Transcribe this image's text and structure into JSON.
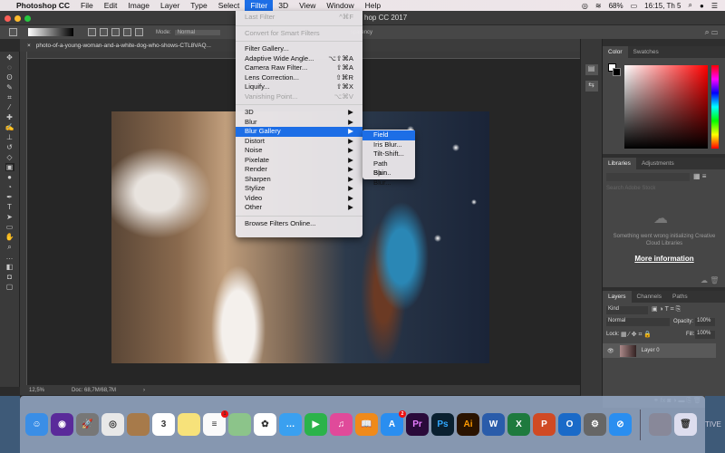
{
  "menubar": {
    "app": "Photoshop CC",
    "items": [
      "File",
      "Edit",
      "Image",
      "Layer",
      "Type",
      "Select",
      "Filter",
      "3D",
      "View",
      "Window",
      "Help"
    ],
    "active": "Filter",
    "status": {
      "battery": "68%",
      "clock": "16:15, Th 5"
    }
  },
  "window": {
    "title": "hop CC 2017"
  },
  "options": {
    "mode_label": "Mode:",
    "mode_value": "Normal",
    "transparency": "sparency"
  },
  "document": {
    "tab": "photo-of-a-young-woman-and-a-white-dog-who-shows-CTL8VAQ...",
    "zoom": "12,5%",
    "doc_size": "Doc: 68,7M/68,7M"
  },
  "filter_menu": {
    "group1": [
      {
        "label": "Last Filter",
        "shortcut": "^⌘F",
        "disabled": true
      }
    ],
    "group2": [
      {
        "label": "Convert for Smart Filters",
        "disabled": true
      }
    ],
    "group3": [
      {
        "label": "Filter Gallery...",
        "shortcut": ""
      },
      {
        "label": "Adaptive Wide Angle...",
        "shortcut": "⌥⇧⌘A"
      },
      {
        "label": "Camera Raw Filter...",
        "shortcut": "⇧⌘A"
      },
      {
        "label": "Lens Correction...",
        "shortcut": "⇧⌘R"
      },
      {
        "label": "Liquify...",
        "shortcut": "⇧⌘X"
      },
      {
        "label": "Vanishing Point...",
        "shortcut": "⌥⌘V",
        "disabled": true
      }
    ],
    "group4": [
      "3D",
      "Blur",
      "Blur Gallery",
      "Distort",
      "Noise",
      "Pixelate",
      "Render",
      "Sharpen",
      "Stylize",
      "Video",
      "Other"
    ],
    "highlighted": "Blur Gallery",
    "group5": [
      "Browse Filters Online..."
    ]
  },
  "blur_gallery_submenu": [
    "Field Blur...",
    "Iris Blur...",
    "Tilt-Shift...",
    "Path Blur...",
    "Spin Blur..."
  ],
  "panels": {
    "color": {
      "tabs": [
        "Color",
        "Swatches"
      ]
    },
    "libraries": {
      "tabs": [
        "Libraries",
        "Adjustments"
      ],
      "search_placeholder": "Search Adobe Stock",
      "error": "Something went wrong initializing Creative Cloud Libraries",
      "link": "More information"
    },
    "layers": {
      "tabs": [
        "Layers",
        "Channels",
        "Paths"
      ],
      "filter": "Kind",
      "blend": "Normal",
      "opacity_label": "Opacity:",
      "opacity": "100%",
      "lock_label": "Lock:",
      "fill_label": "Fill:",
      "fill": "100%",
      "layer_name": "Layer 0"
    }
  },
  "dock": {
    "apps": [
      {
        "name": "Finder",
        "color": "#3a8ee6",
        "text": "☺"
      },
      {
        "name": "Siri",
        "color": "#5a2a9a",
        "text": "◉"
      },
      {
        "name": "Launchpad",
        "color": "#777",
        "text": "🚀"
      },
      {
        "name": "Chrome",
        "color": "#e8e8e8",
        "text": "◎"
      },
      {
        "name": "Contacts",
        "color": "#a77a4a",
        "text": ""
      },
      {
        "name": "Calendar",
        "color": "#fff",
        "text": "3"
      },
      {
        "name": "Notes",
        "color": "#f7e27a",
        "text": ""
      },
      {
        "name": "Reminders",
        "color": "#fafafa",
        "text": "≡",
        "badge": "1"
      },
      {
        "name": "Maps",
        "color": "#8cc48a",
        "text": ""
      },
      {
        "name": "Photos",
        "color": "#fff",
        "text": "✿"
      },
      {
        "name": "Messages",
        "color": "#3aa0f0",
        "text": "…"
      },
      {
        "name": "FaceTime",
        "color": "#2bb34a",
        "text": "▶"
      },
      {
        "name": "iTunes",
        "color": "#e04a9a",
        "text": "♫"
      },
      {
        "name": "iBooks",
        "color": "#f08a1a",
        "text": "📖"
      },
      {
        "name": "App Store",
        "color": "#2a8ef0",
        "text": "A",
        "badge": "2"
      },
      {
        "name": "Premiere",
        "color": "#2a0a3a",
        "text": "Pr"
      },
      {
        "name": "Photoshop",
        "color": "#0a2030",
        "text": "Ps"
      },
      {
        "name": "Illustrator",
        "color": "#2a1300",
        "text": "Ai"
      },
      {
        "name": "Word",
        "color": "#2a5caa",
        "text": "W"
      },
      {
        "name": "Excel",
        "color": "#1e7a3e",
        "text": "X"
      },
      {
        "name": "PowerPoint",
        "color": "#d04a24",
        "text": "P"
      },
      {
        "name": "Outlook",
        "color": "#1a6ac8",
        "text": "O"
      },
      {
        "name": "System Preferences",
        "color": "#666",
        "text": "⚙"
      },
      {
        "name": "Safari",
        "color": "#2a8ef0",
        "text": "⊘"
      },
      {
        "name": "Downloads",
        "color": "#889",
        "text": ""
      },
      {
        "name": "Trash",
        "color": "#dde",
        "text": "🗑"
      }
    ]
  },
  "desktop_text": "TIVE"
}
